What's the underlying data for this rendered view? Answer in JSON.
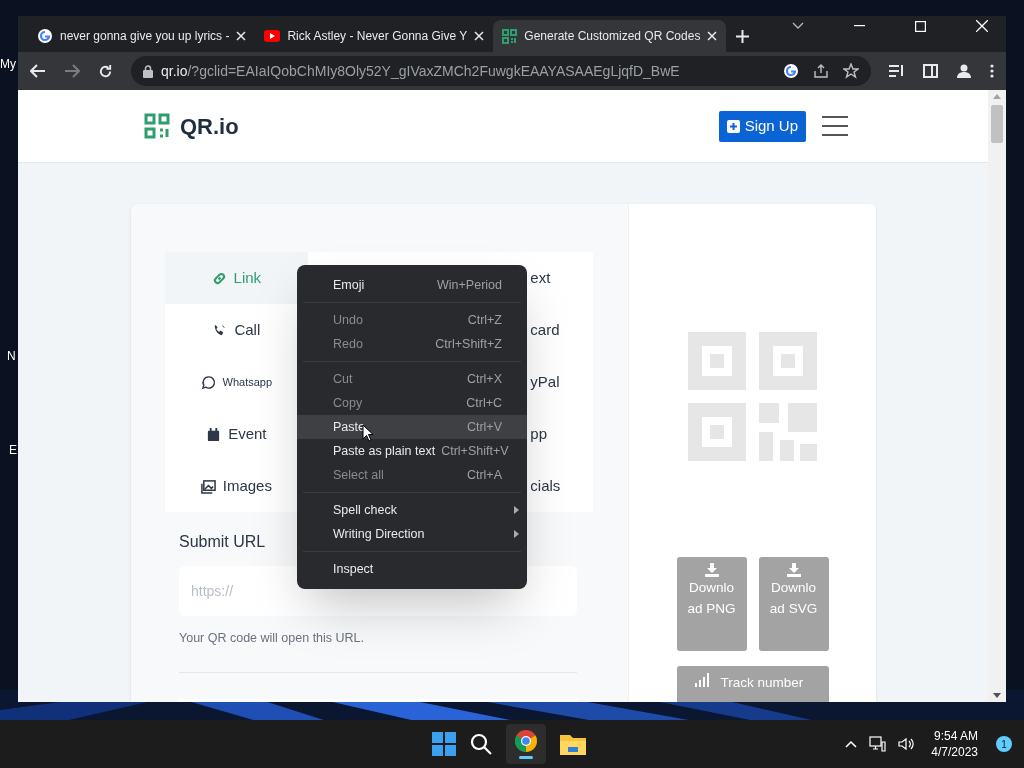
{
  "desktop_labels": [
    "My",
    "N",
    "E"
  ],
  "browser": {
    "tabs": [
      {
        "title": "never gonna give you up lyrics -",
        "selected": false,
        "kind": "google"
      },
      {
        "title": "Rick Astley - Never Gonna Give Y",
        "selected": false,
        "kind": "youtube"
      },
      {
        "title": "Generate Customized QR Codes",
        "selected": true,
        "kind": "qr"
      }
    ],
    "address": {
      "host": "qr.io",
      "path": "/?gclid=EAIaIQobChMIy8Oly52Y_gIVaxZMCh2FuwgkEAAYASAAEgLjqfD_BwE"
    }
  },
  "page": {
    "logo": "QR.io",
    "sign_up": "Sign Up",
    "type_tabs_left": [
      {
        "label": "Link",
        "selected": true
      },
      {
        "label": "Call",
        "selected": false
      },
      {
        "label": "Whatsapp",
        "selected": false
      },
      {
        "label": "Event",
        "selected": false
      },
      {
        "label": "Images",
        "selected": false
      }
    ],
    "type_tabs_right": [
      {
        "label": "ext",
        "selected": false
      },
      {
        "label": "card",
        "selected": false
      },
      {
        "label": "yPal",
        "selected": false
      },
      {
        "label": "pp",
        "selected": false
      },
      {
        "label": "cials",
        "selected": false
      }
    ],
    "url_label": "Submit URL",
    "url_placeholder": "https://",
    "url_help": "Your QR code will open this URL.",
    "download_buttons": [
      {
        "label": "Download PNG",
        "disabled": true
      },
      {
        "label": "Download SVG",
        "disabled": true
      }
    ],
    "track_button": {
      "label": "Track number",
      "disabled": true
    }
  },
  "context_menu": [
    {
      "kind": "item",
      "label": "Emoji",
      "shortcut": "Win+Period",
      "disabled": false,
      "selected": false
    },
    {
      "kind": "separator"
    },
    {
      "kind": "item",
      "label": "Undo",
      "shortcut": "Ctrl+Z",
      "disabled": true,
      "selected": false
    },
    {
      "kind": "item",
      "label": "Redo",
      "shortcut": "Ctrl+Shift+Z",
      "disabled": true,
      "selected": false
    },
    {
      "kind": "separator"
    },
    {
      "kind": "item",
      "label": "Cut",
      "shortcut": "Ctrl+X",
      "disabled": true,
      "selected": false
    },
    {
      "kind": "item",
      "label": "Copy",
      "shortcut": "Ctrl+C",
      "disabled": true,
      "selected": false
    },
    {
      "kind": "item",
      "label": "Paste",
      "shortcut": "Ctrl+V",
      "disabled": false,
      "selected": true
    },
    {
      "kind": "item",
      "label": "Paste as plain text",
      "shortcut": "Ctrl+Shift+V",
      "disabled": false,
      "selected": false
    },
    {
      "kind": "item",
      "label": "Select all",
      "shortcut": "Ctrl+A",
      "disabled": true,
      "selected": false
    },
    {
      "kind": "separator"
    },
    {
      "kind": "submenu",
      "label": "Spell check"
    },
    {
      "kind": "submenu",
      "label": "Writing Direction"
    },
    {
      "kind": "separator"
    },
    {
      "kind": "item",
      "label": "Inspect",
      "disabled": false,
      "selected": false
    }
  ],
  "taskbar": {
    "time": "9:54 AM",
    "date": "4/7/2023",
    "notifications": "1"
  }
}
